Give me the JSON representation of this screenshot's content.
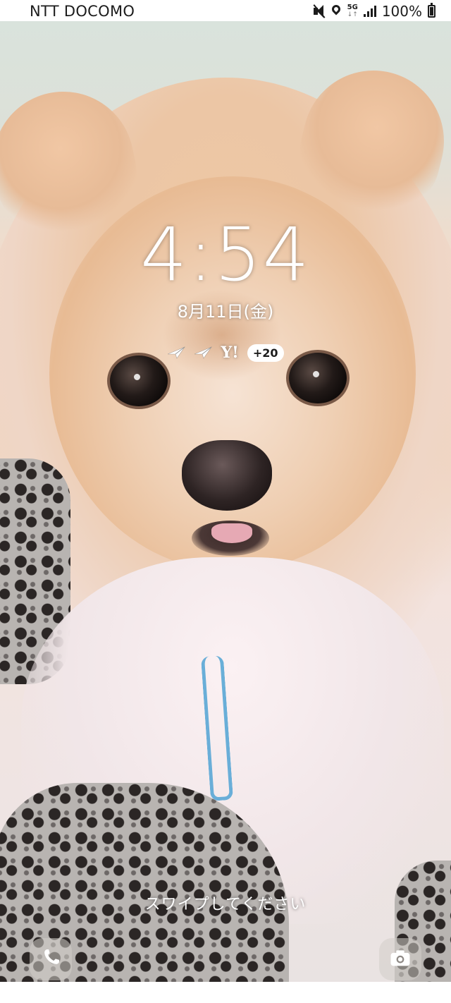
{
  "status_bar": {
    "carrier": "NTT DOCOMO",
    "network": "5G",
    "battery": "100%"
  },
  "lock_screen": {
    "time": "4:54",
    "date": "8月11日(金)",
    "notifications": {
      "icons": [
        "paper-plane-icon",
        "paper-plane-icon",
        "yahoo-icon"
      ],
      "yahoo_label": "Y!",
      "more_count": "+20"
    },
    "swipe_hint": "スワイプしてください",
    "shortcuts": {
      "left": "phone-icon",
      "right": "camera-icon"
    }
  },
  "wallpaper": {
    "subject": "pomeranian-dog",
    "colors": {
      "fur": "#efc9a4",
      "chest": "#f1e6e8",
      "leash": "#5aa8d6"
    }
  }
}
